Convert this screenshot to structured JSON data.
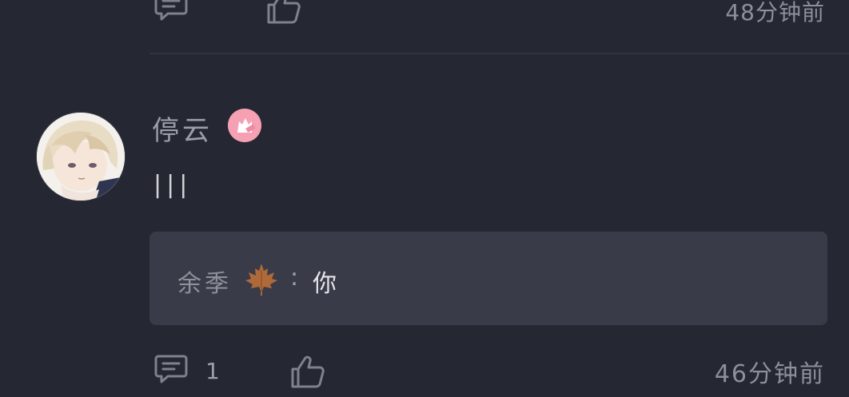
{
  "previous": {
    "time": "48分钟前"
  },
  "comment": {
    "username": "停云",
    "content": "|||",
    "reply": {
      "author": "余季",
      "separator": ":",
      "text": "你"
    },
    "reply_count": "1",
    "time": "46分钟前"
  },
  "icons": {
    "comment": "comment-icon",
    "like": "thumbs-up-icon",
    "maple": "maple-leaf-icon",
    "badge": "year-badge-icon"
  },
  "colors": {
    "background": "#252733",
    "reply_box": "#393b48",
    "badge": "#f6a0b3"
  }
}
